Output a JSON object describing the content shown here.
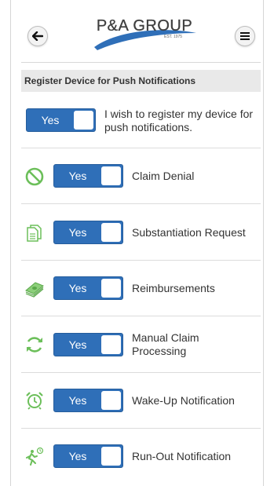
{
  "header": {
    "logo": {
      "wordmark": "P&A GROUP",
      "est": "EST. 1975"
    },
    "back_icon": "arrow-left-icon",
    "menu_icon": "hamburger-menu-icon"
  },
  "section": {
    "title": "Register Device for Push Notifications"
  },
  "register": {
    "toggle_label": "Yes",
    "label": "I wish to register my device for push notifications."
  },
  "notifications": [
    {
      "icon": "prohibited-icon",
      "toggle_label": "Yes",
      "label": "Claim Denial"
    },
    {
      "icon": "documents-icon",
      "toggle_label": "Yes",
      "label": "Substantiation Request"
    },
    {
      "icon": "money-stack-icon",
      "toggle_label": "Yes",
      "label": "Reimbursements"
    },
    {
      "icon": "refresh-icon",
      "toggle_label": "Yes",
      "label": "Manual Claim Processing"
    },
    {
      "icon": "alarm-clock-icon",
      "toggle_label": "Yes",
      "label": "Wake-Up Notification"
    },
    {
      "icon": "runner-clock-icon",
      "toggle_label": "Yes",
      "label": "Run-Out Notification"
    }
  ],
  "colors": {
    "accent": "#2f6fb8",
    "icon_green": "#6cbf5a",
    "section_bg": "#e9e9e9"
  }
}
